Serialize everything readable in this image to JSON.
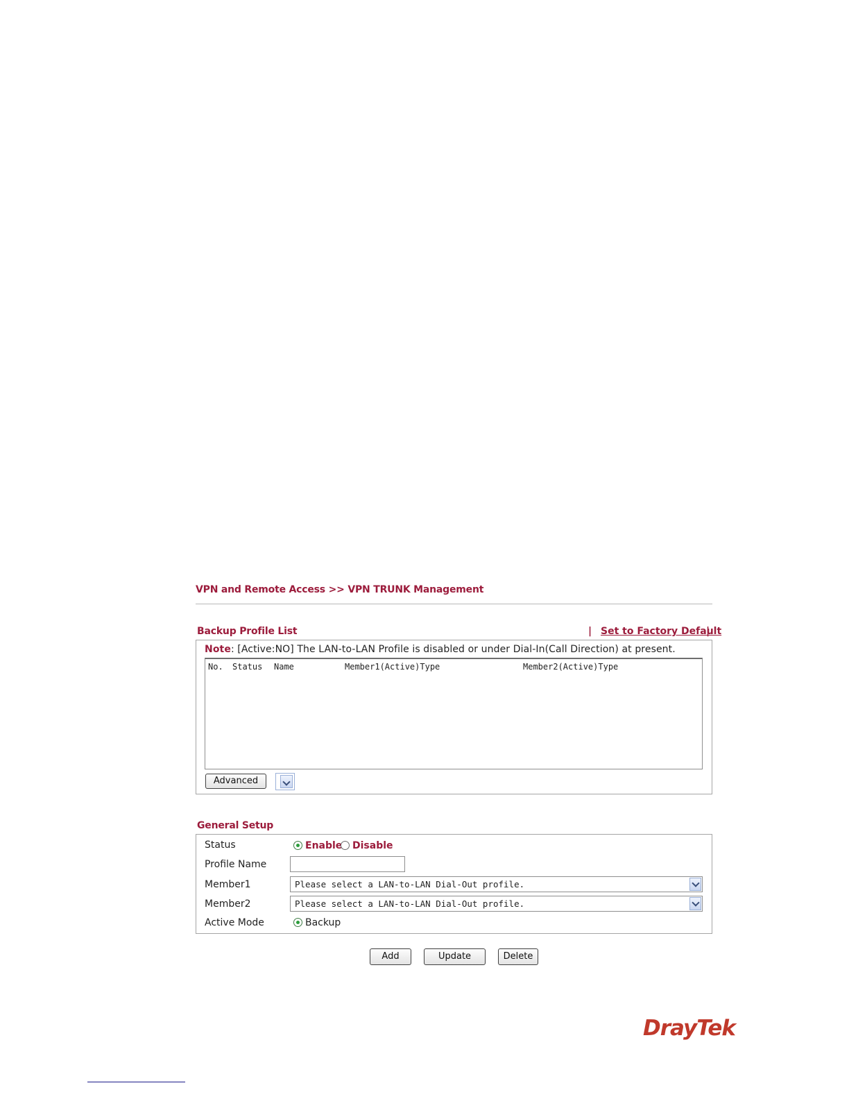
{
  "breadcrumb": "VPN and Remote Access >> VPN TRUNK Management",
  "backup_list": {
    "title": "Backup Profile List",
    "pipe": "|",
    "factory_link": "Set to Factory Default",
    "note_label": "Note",
    "note_text": ": [Active:NO] The LAN-to-LAN Profile is disabled or under Dial-In(Call Direction) at present.",
    "columns": [
      "No.",
      "Status",
      "Name",
      "Member1(Active)Type",
      "Member2(Active)Type"
    ],
    "advanced_label": "Advanced"
  },
  "general_setup": {
    "title": "General Setup",
    "status_label": "Status",
    "status_options": [
      "Enable",
      "Disable"
    ],
    "status_selected": "Enable",
    "profile_name_label": "Profile Name",
    "profile_name_value": "",
    "member1_label": "Member1",
    "member1_value": "Please select a LAN-to-LAN Dial-Out profile.",
    "member2_label": "Member2",
    "member2_value": "Please select a LAN-to-LAN Dial-Out profile.",
    "active_mode_label": "Active Mode",
    "active_mode_option": "Backup"
  },
  "actions": {
    "add": "Add",
    "update": "Update",
    "delete": "Delete"
  },
  "logo": "DrayTek",
  "colors": {
    "accent": "#9c1c3c",
    "logo": "#c0392b",
    "radio_dot": "#2a9d3a"
  },
  "icons": {
    "dropdown": "chevron-down-icon",
    "radio_on": "radio-selected-icon",
    "radio_off": "radio-unselected-icon"
  }
}
